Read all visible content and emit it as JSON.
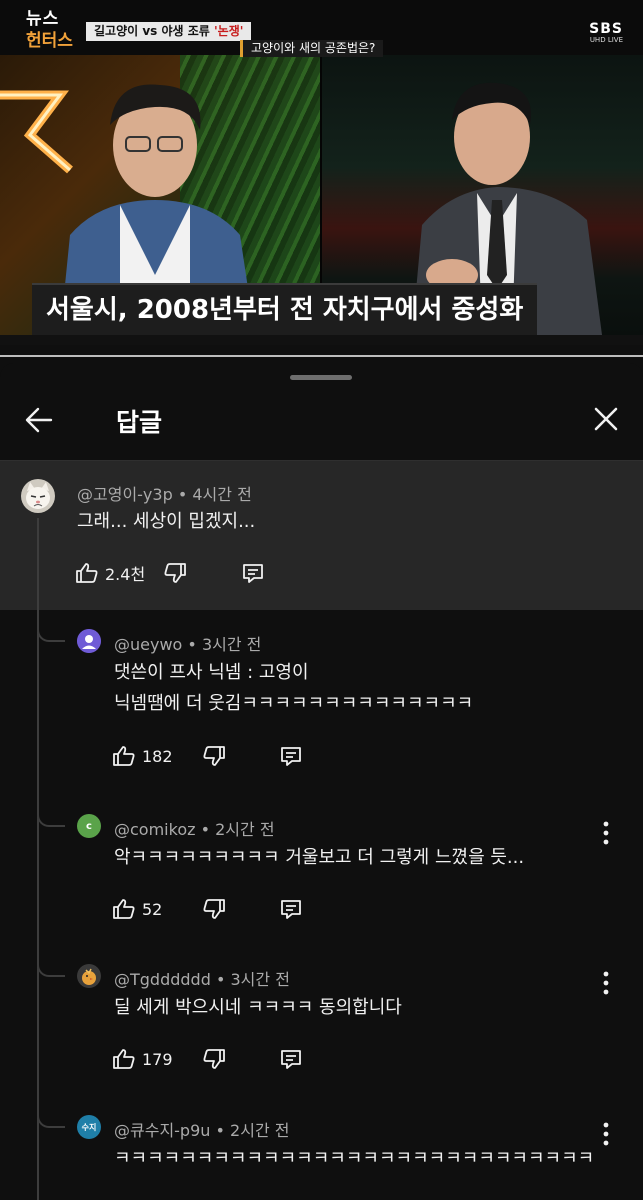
{
  "video": {
    "logo_top": "뉴스",
    "logo_bottom": "헌터스",
    "headline_part1": "길고양이 vs 야생 조류 ",
    "headline_accent": "'논쟁'",
    "subheadline": "고양이와 새의 공존법은?",
    "channel": "SBS",
    "channel_sub": "UHD LIVE",
    "caption": "서울시, 2008년부터 전 자치구에서 중성화"
  },
  "sheet": {
    "title": "답글"
  },
  "parent_comment": {
    "author": "@고영이-y3p",
    "time": "4시간 전",
    "text": "그래... 세상이 밉겠지...",
    "likes": "2.4천",
    "avatar_icon": "cat-avatar-icon"
  },
  "replies": [
    {
      "author": "@ueywo",
      "time": "3시간 전",
      "lines": [
        "댓쓴이 프사 닉넴 : 고영이",
        "닉넴땜에 더 웃김ㅋㅋㅋㅋㅋㅋㅋㅋㅋㅋㅋㅋㅋㅋ"
      ],
      "likes": "182",
      "avatar_color": "#6f5bd6"
    },
    {
      "author": "@comikoz",
      "time": "2시간 전",
      "lines": [
        "악ㅋㅋㅋㅋㅋㅋㅋㅋㅋ 거울보고 더 그렇게 느꼈을 듯..."
      ],
      "likes": "52",
      "avatar_letter": "c",
      "avatar_color": "#5aa34a"
    },
    {
      "author": "@Tgdddddd",
      "time": "3시간 전",
      "lines": [
        "딜 세게 박으시네 ㅋㅋㅋㅋ 동의합니다"
      ],
      "likes": "179",
      "avatar_color": "#e8a23c"
    },
    {
      "author": "@큐수지-p9u",
      "time": "2시간 전",
      "lines": [
        "ㅋㅋㅋㅋㅋㅋㅋㅋㅋㅋㅋㅋㅋㅋㅋㅋㅋㅋㅋㅋㅋㅋㅋㅋㅋㅋㅋㅋㅋ"
      ],
      "avatar_letter": "수지",
      "avatar_color": "#1f7fa8"
    }
  ]
}
